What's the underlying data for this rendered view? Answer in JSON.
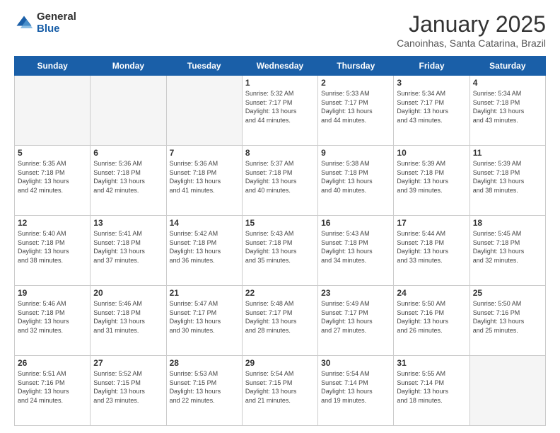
{
  "logo": {
    "general": "General",
    "blue": "Blue"
  },
  "header": {
    "month": "January 2025",
    "location": "Canoinhas, Santa Catarina, Brazil"
  },
  "weekdays": [
    "Sunday",
    "Monday",
    "Tuesday",
    "Wednesday",
    "Thursday",
    "Friday",
    "Saturday"
  ],
  "weeks": [
    [
      {
        "day": "",
        "info": ""
      },
      {
        "day": "",
        "info": ""
      },
      {
        "day": "",
        "info": ""
      },
      {
        "day": "1",
        "info": "Sunrise: 5:32 AM\nSunset: 7:17 PM\nDaylight: 13 hours\nand 44 minutes."
      },
      {
        "day": "2",
        "info": "Sunrise: 5:33 AM\nSunset: 7:17 PM\nDaylight: 13 hours\nand 44 minutes."
      },
      {
        "day": "3",
        "info": "Sunrise: 5:34 AM\nSunset: 7:17 PM\nDaylight: 13 hours\nand 43 minutes."
      },
      {
        "day": "4",
        "info": "Sunrise: 5:34 AM\nSunset: 7:18 PM\nDaylight: 13 hours\nand 43 minutes."
      }
    ],
    [
      {
        "day": "5",
        "info": "Sunrise: 5:35 AM\nSunset: 7:18 PM\nDaylight: 13 hours\nand 42 minutes."
      },
      {
        "day": "6",
        "info": "Sunrise: 5:36 AM\nSunset: 7:18 PM\nDaylight: 13 hours\nand 42 minutes."
      },
      {
        "day": "7",
        "info": "Sunrise: 5:36 AM\nSunset: 7:18 PM\nDaylight: 13 hours\nand 41 minutes."
      },
      {
        "day": "8",
        "info": "Sunrise: 5:37 AM\nSunset: 7:18 PM\nDaylight: 13 hours\nand 40 minutes."
      },
      {
        "day": "9",
        "info": "Sunrise: 5:38 AM\nSunset: 7:18 PM\nDaylight: 13 hours\nand 40 minutes."
      },
      {
        "day": "10",
        "info": "Sunrise: 5:39 AM\nSunset: 7:18 PM\nDaylight: 13 hours\nand 39 minutes."
      },
      {
        "day": "11",
        "info": "Sunrise: 5:39 AM\nSunset: 7:18 PM\nDaylight: 13 hours\nand 38 minutes."
      }
    ],
    [
      {
        "day": "12",
        "info": "Sunrise: 5:40 AM\nSunset: 7:18 PM\nDaylight: 13 hours\nand 38 minutes."
      },
      {
        "day": "13",
        "info": "Sunrise: 5:41 AM\nSunset: 7:18 PM\nDaylight: 13 hours\nand 37 minutes."
      },
      {
        "day": "14",
        "info": "Sunrise: 5:42 AM\nSunset: 7:18 PM\nDaylight: 13 hours\nand 36 minutes."
      },
      {
        "day": "15",
        "info": "Sunrise: 5:43 AM\nSunset: 7:18 PM\nDaylight: 13 hours\nand 35 minutes."
      },
      {
        "day": "16",
        "info": "Sunrise: 5:43 AM\nSunset: 7:18 PM\nDaylight: 13 hours\nand 34 minutes."
      },
      {
        "day": "17",
        "info": "Sunrise: 5:44 AM\nSunset: 7:18 PM\nDaylight: 13 hours\nand 33 minutes."
      },
      {
        "day": "18",
        "info": "Sunrise: 5:45 AM\nSunset: 7:18 PM\nDaylight: 13 hours\nand 32 minutes."
      }
    ],
    [
      {
        "day": "19",
        "info": "Sunrise: 5:46 AM\nSunset: 7:18 PM\nDaylight: 13 hours\nand 32 minutes."
      },
      {
        "day": "20",
        "info": "Sunrise: 5:46 AM\nSunset: 7:18 PM\nDaylight: 13 hours\nand 31 minutes."
      },
      {
        "day": "21",
        "info": "Sunrise: 5:47 AM\nSunset: 7:17 PM\nDaylight: 13 hours\nand 30 minutes."
      },
      {
        "day": "22",
        "info": "Sunrise: 5:48 AM\nSunset: 7:17 PM\nDaylight: 13 hours\nand 28 minutes."
      },
      {
        "day": "23",
        "info": "Sunrise: 5:49 AM\nSunset: 7:17 PM\nDaylight: 13 hours\nand 27 minutes."
      },
      {
        "day": "24",
        "info": "Sunrise: 5:50 AM\nSunset: 7:16 PM\nDaylight: 13 hours\nand 26 minutes."
      },
      {
        "day": "25",
        "info": "Sunrise: 5:50 AM\nSunset: 7:16 PM\nDaylight: 13 hours\nand 25 minutes."
      }
    ],
    [
      {
        "day": "26",
        "info": "Sunrise: 5:51 AM\nSunset: 7:16 PM\nDaylight: 13 hours\nand 24 minutes."
      },
      {
        "day": "27",
        "info": "Sunrise: 5:52 AM\nSunset: 7:15 PM\nDaylight: 13 hours\nand 23 minutes."
      },
      {
        "day": "28",
        "info": "Sunrise: 5:53 AM\nSunset: 7:15 PM\nDaylight: 13 hours\nand 22 minutes."
      },
      {
        "day": "29",
        "info": "Sunrise: 5:54 AM\nSunset: 7:15 PM\nDaylight: 13 hours\nand 21 minutes."
      },
      {
        "day": "30",
        "info": "Sunrise: 5:54 AM\nSunset: 7:14 PM\nDaylight: 13 hours\nand 19 minutes."
      },
      {
        "day": "31",
        "info": "Sunrise: 5:55 AM\nSunset: 7:14 PM\nDaylight: 13 hours\nand 18 minutes."
      },
      {
        "day": "",
        "info": ""
      }
    ]
  ]
}
